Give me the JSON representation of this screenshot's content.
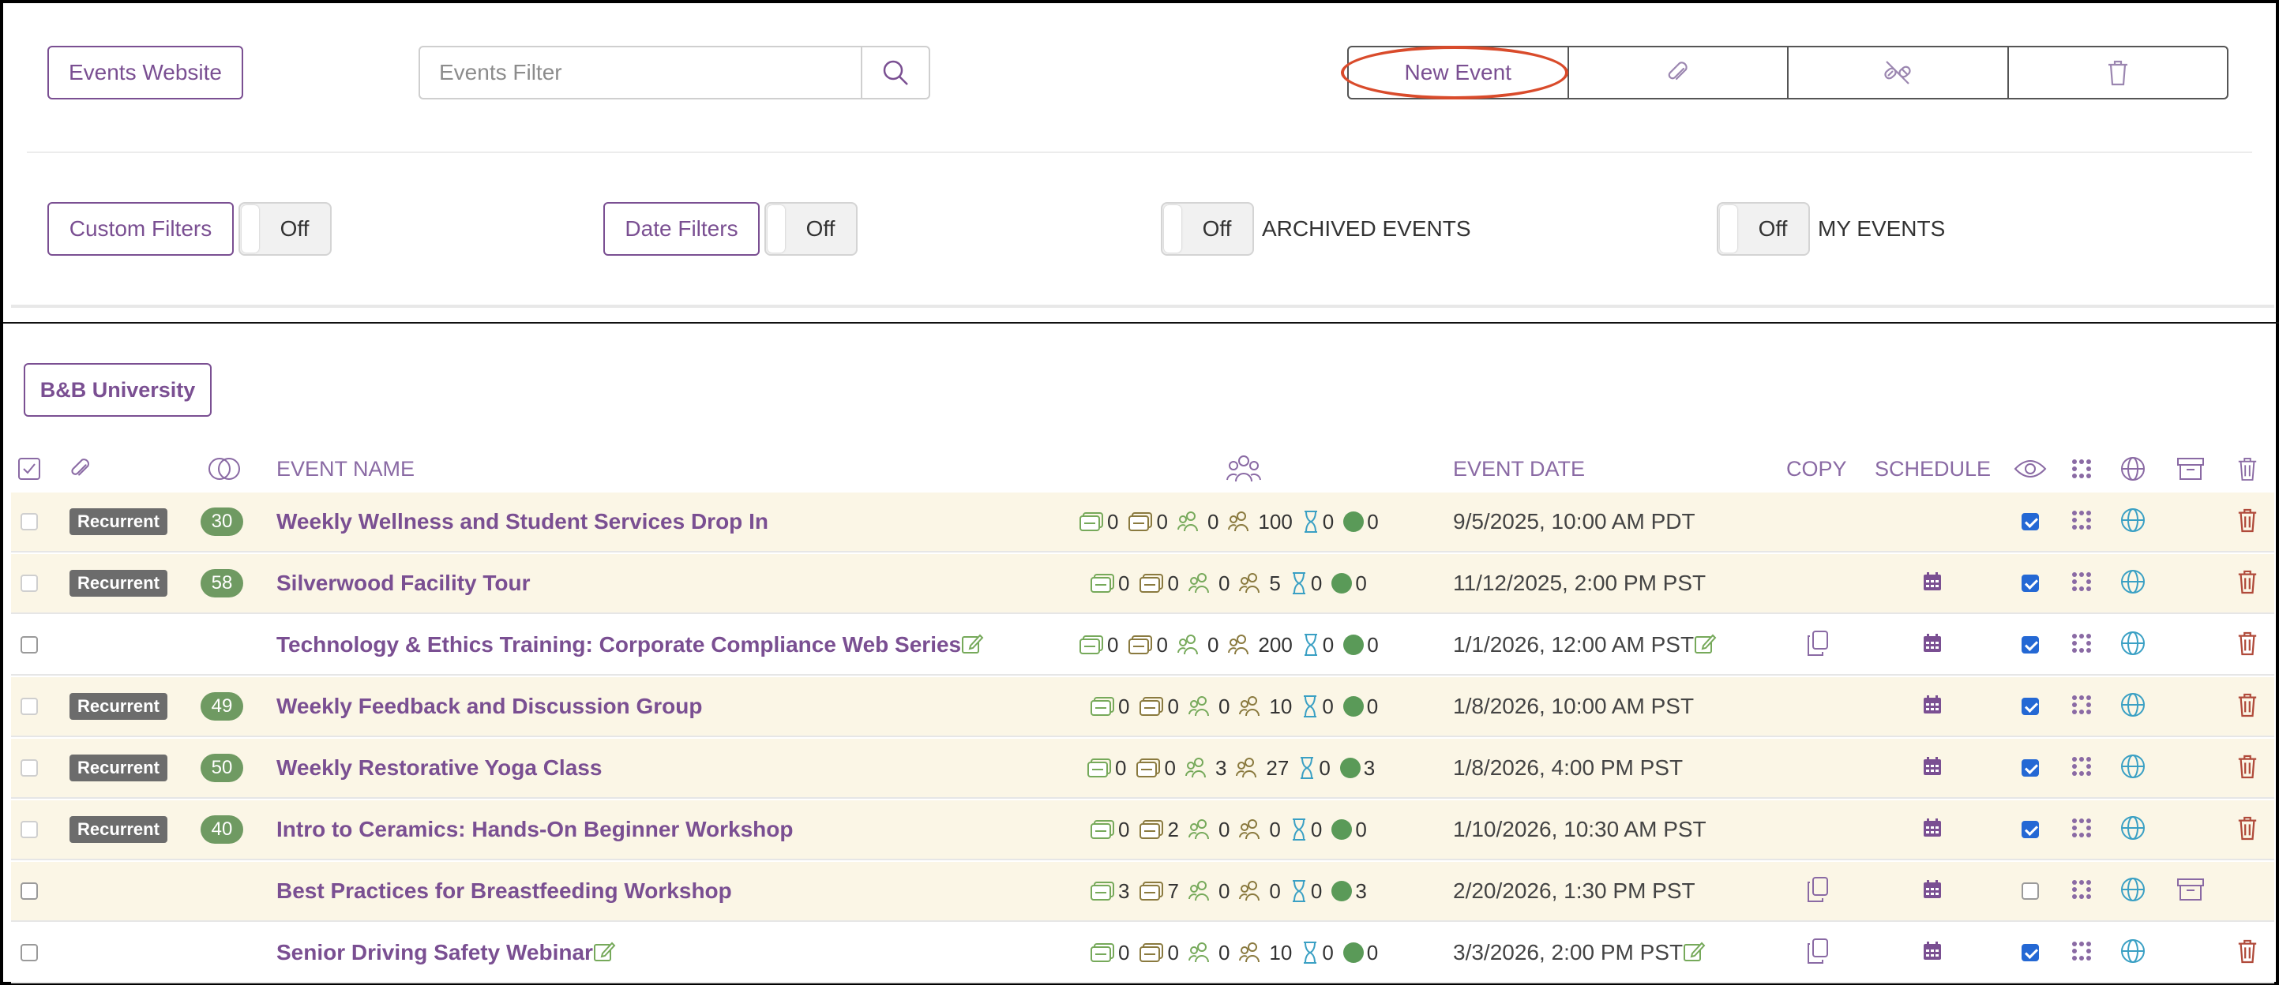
{
  "toolbar": {
    "website_label": "Events Website",
    "filter_placeholder": "Events Filter",
    "new_event_label": "New Event"
  },
  "filters": {
    "custom_label": "Custom Filters",
    "custom_toggle": "Off",
    "date_label": "Date Filters",
    "date_toggle": "Off",
    "archived_toggle": "Off",
    "archived_label": "ARCHIVED EVENTS",
    "my_toggle": "Off",
    "my_label": "MY EVENTS"
  },
  "org_label": "B&B University",
  "table": {
    "headers": {
      "event_name": "EVENT NAME",
      "event_date": "EVENT DATE",
      "copy": "COPY",
      "schedule": "SCHEDULE"
    },
    "rows": [
      {
        "recurrent": "Recurrent",
        "count": "30",
        "name": "Weekly Wellness and Student Services Drop In",
        "edit": false,
        "stats": [
          "0",
          "0",
          "0",
          "100",
          "0",
          "0"
        ],
        "date": "9/5/2025, 10:00 AM PDT",
        "date_edit": false,
        "copy": false,
        "schedule": false,
        "visible": true,
        "archive": false
      },
      {
        "recurrent": "Recurrent",
        "count": "58",
        "name": "Silverwood Facility Tour",
        "edit": false,
        "stats": [
          "0",
          "0",
          "0",
          "5",
          "0",
          "0"
        ],
        "date": "11/12/2025, 2:00 PM PST",
        "date_edit": false,
        "copy": false,
        "schedule": true,
        "visible": true,
        "archive": false
      },
      {
        "recurrent": "",
        "count": "",
        "name": "Technology & Ethics Training: Corporate Compliance Web Series",
        "edit": true,
        "stats": [
          "0",
          "0",
          "0",
          "200",
          "0",
          "0"
        ],
        "date": "1/1/2026, 12:00 AM PST",
        "date_edit": true,
        "copy": true,
        "schedule": true,
        "visible": true,
        "archive": false
      },
      {
        "recurrent": "Recurrent",
        "count": "49",
        "name": "Weekly Feedback and Discussion Group",
        "edit": false,
        "stats": [
          "0",
          "0",
          "0",
          "10",
          "0",
          "0"
        ],
        "date": "1/8/2026, 10:00 AM PST",
        "date_edit": false,
        "copy": false,
        "schedule": true,
        "visible": true,
        "archive": false
      },
      {
        "recurrent": "Recurrent",
        "count": "50",
        "name": "Weekly Restorative Yoga Class",
        "edit": false,
        "stats": [
          "0",
          "0",
          "3",
          "27",
          "0",
          "3"
        ],
        "date": "1/8/2026, 4:00 PM PST",
        "date_edit": false,
        "copy": false,
        "schedule": true,
        "visible": true,
        "archive": false
      },
      {
        "recurrent": "Recurrent",
        "count": "40",
        "name": "Intro to Ceramics: Hands-On Beginner Workshop",
        "edit": false,
        "stats": [
          "0",
          "2",
          "0",
          "0",
          "0",
          "0"
        ],
        "date": "1/10/2026, 10:30 AM PST",
        "date_edit": false,
        "copy": false,
        "schedule": true,
        "visible": true,
        "archive": false
      },
      {
        "recurrent": "",
        "count": "",
        "name": "Best Practices for Breastfeeding Workshop",
        "edit": false,
        "stats": [
          "3",
          "7",
          "0",
          "0",
          "0",
          "3"
        ],
        "date": "2/20/2026, 1:30 PM PST",
        "date_edit": false,
        "copy": true,
        "schedule": true,
        "visible": false,
        "archive": true
      },
      {
        "recurrent": "",
        "count": "",
        "name": "Senior Driving Safety Webinar",
        "edit": true,
        "stats": [
          "0",
          "0",
          "0",
          "10",
          "0",
          "0"
        ],
        "date": "3/3/2026, 2:00 PM PST",
        "date_edit": true,
        "copy": true,
        "schedule": true,
        "visible": true,
        "archive": false
      }
    ]
  },
  "colors": {
    "accent": "#7a4f92",
    "row_tint": "#fbf6e6",
    "count_badge": "#6f9a62",
    "highlight": "#d94b2b",
    "delete": "#b04a3a",
    "globe": "#3aa0c4"
  }
}
